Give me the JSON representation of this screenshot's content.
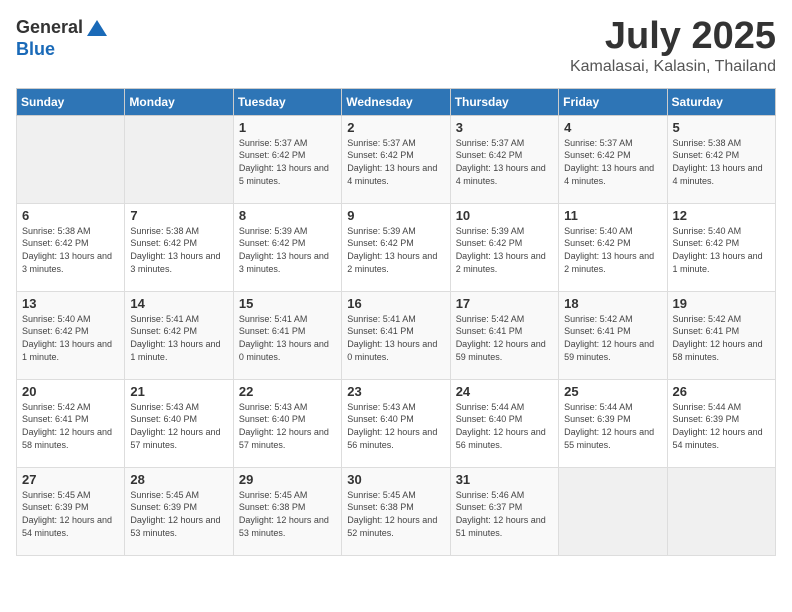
{
  "header": {
    "logo_general": "General",
    "logo_blue": "Blue",
    "month_title": "July 2025",
    "location": "Kamalasai, Kalasin, Thailand"
  },
  "weekdays": [
    "Sunday",
    "Monday",
    "Tuesday",
    "Wednesday",
    "Thursday",
    "Friday",
    "Saturday"
  ],
  "weeks": [
    [
      {
        "day": "",
        "empty": true
      },
      {
        "day": "",
        "empty": true
      },
      {
        "day": "1",
        "sunrise": "5:37 AM",
        "sunset": "6:42 PM",
        "daylight": "13 hours and 5 minutes."
      },
      {
        "day": "2",
        "sunrise": "5:37 AM",
        "sunset": "6:42 PM",
        "daylight": "13 hours and 4 minutes."
      },
      {
        "day": "3",
        "sunrise": "5:37 AM",
        "sunset": "6:42 PM",
        "daylight": "13 hours and 4 minutes."
      },
      {
        "day": "4",
        "sunrise": "5:37 AM",
        "sunset": "6:42 PM",
        "daylight": "13 hours and 4 minutes."
      },
      {
        "day": "5",
        "sunrise": "5:38 AM",
        "sunset": "6:42 PM",
        "daylight": "13 hours and 4 minutes."
      }
    ],
    [
      {
        "day": "6",
        "sunrise": "5:38 AM",
        "sunset": "6:42 PM",
        "daylight": "13 hours and 3 minutes."
      },
      {
        "day": "7",
        "sunrise": "5:38 AM",
        "sunset": "6:42 PM",
        "daylight": "13 hours and 3 minutes."
      },
      {
        "day": "8",
        "sunrise": "5:39 AM",
        "sunset": "6:42 PM",
        "daylight": "13 hours and 3 minutes."
      },
      {
        "day": "9",
        "sunrise": "5:39 AM",
        "sunset": "6:42 PM",
        "daylight": "13 hours and 2 minutes."
      },
      {
        "day": "10",
        "sunrise": "5:39 AM",
        "sunset": "6:42 PM",
        "daylight": "13 hours and 2 minutes."
      },
      {
        "day": "11",
        "sunrise": "5:40 AM",
        "sunset": "6:42 PM",
        "daylight": "13 hours and 2 minutes."
      },
      {
        "day": "12",
        "sunrise": "5:40 AM",
        "sunset": "6:42 PM",
        "daylight": "13 hours and 1 minute."
      }
    ],
    [
      {
        "day": "13",
        "sunrise": "5:40 AM",
        "sunset": "6:42 PM",
        "daylight": "13 hours and 1 minute."
      },
      {
        "day": "14",
        "sunrise": "5:41 AM",
        "sunset": "6:42 PM",
        "daylight": "13 hours and 1 minute."
      },
      {
        "day": "15",
        "sunrise": "5:41 AM",
        "sunset": "6:41 PM",
        "daylight": "13 hours and 0 minutes."
      },
      {
        "day": "16",
        "sunrise": "5:41 AM",
        "sunset": "6:41 PM",
        "daylight": "13 hours and 0 minutes."
      },
      {
        "day": "17",
        "sunrise": "5:42 AM",
        "sunset": "6:41 PM",
        "daylight": "12 hours and 59 minutes."
      },
      {
        "day": "18",
        "sunrise": "5:42 AM",
        "sunset": "6:41 PM",
        "daylight": "12 hours and 59 minutes."
      },
      {
        "day": "19",
        "sunrise": "5:42 AM",
        "sunset": "6:41 PM",
        "daylight": "12 hours and 58 minutes."
      }
    ],
    [
      {
        "day": "20",
        "sunrise": "5:42 AM",
        "sunset": "6:41 PM",
        "daylight": "12 hours and 58 minutes."
      },
      {
        "day": "21",
        "sunrise": "5:43 AM",
        "sunset": "6:40 PM",
        "daylight": "12 hours and 57 minutes."
      },
      {
        "day": "22",
        "sunrise": "5:43 AM",
        "sunset": "6:40 PM",
        "daylight": "12 hours and 57 minutes."
      },
      {
        "day": "23",
        "sunrise": "5:43 AM",
        "sunset": "6:40 PM",
        "daylight": "12 hours and 56 minutes."
      },
      {
        "day": "24",
        "sunrise": "5:44 AM",
        "sunset": "6:40 PM",
        "daylight": "12 hours and 56 minutes."
      },
      {
        "day": "25",
        "sunrise": "5:44 AM",
        "sunset": "6:39 PM",
        "daylight": "12 hours and 55 minutes."
      },
      {
        "day": "26",
        "sunrise": "5:44 AM",
        "sunset": "6:39 PM",
        "daylight": "12 hours and 54 minutes."
      }
    ],
    [
      {
        "day": "27",
        "sunrise": "5:45 AM",
        "sunset": "6:39 PM",
        "daylight": "12 hours and 54 minutes."
      },
      {
        "day": "28",
        "sunrise": "5:45 AM",
        "sunset": "6:39 PM",
        "daylight": "12 hours and 53 minutes."
      },
      {
        "day": "29",
        "sunrise": "5:45 AM",
        "sunset": "6:38 PM",
        "daylight": "12 hours and 53 minutes."
      },
      {
        "day": "30",
        "sunrise": "5:45 AM",
        "sunset": "6:38 PM",
        "daylight": "12 hours and 52 minutes."
      },
      {
        "day": "31",
        "sunrise": "5:46 AM",
        "sunset": "6:37 PM",
        "daylight": "12 hours and 51 minutes."
      },
      {
        "day": "",
        "empty": true
      },
      {
        "day": "",
        "empty": true
      }
    ]
  ]
}
